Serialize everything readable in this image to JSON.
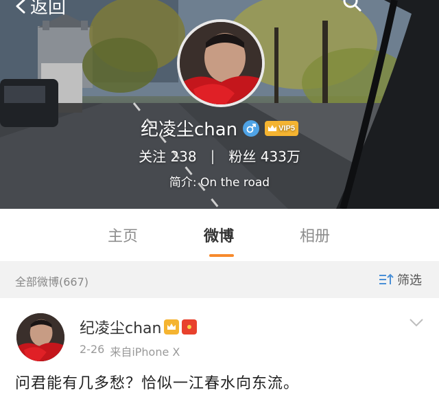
{
  "nav": {
    "back_label": "返回"
  },
  "profile": {
    "name": "纪凌尘chan",
    "vip_label": "VIP5",
    "following_label": "关注",
    "following_count": "238",
    "followers_label": "粉丝",
    "followers_count": "433万",
    "bio_prefix": "简介:",
    "bio": "On the road"
  },
  "tabs": [
    {
      "label": "主页",
      "active": false
    },
    {
      "label": "微博",
      "active": true
    },
    {
      "label": "相册",
      "active": false
    }
  ],
  "filter": {
    "all_label": "全部微博(667)",
    "filter_label": "筛选"
  },
  "post": {
    "author": "纪凌尘chan",
    "date": "2-26",
    "source": "来自iPhone X",
    "text": "问君能有几多愁？恰似一江春水向东流。"
  },
  "colors": {
    "accent": "#f78a2c",
    "gender_badge": "#4fa3e6",
    "vip_badge": "#f5b431"
  },
  "icons": [
    "back-arrow-icon",
    "search-icon",
    "male-icon",
    "crown-icon",
    "filter-icon",
    "chevron-down-icon"
  ]
}
